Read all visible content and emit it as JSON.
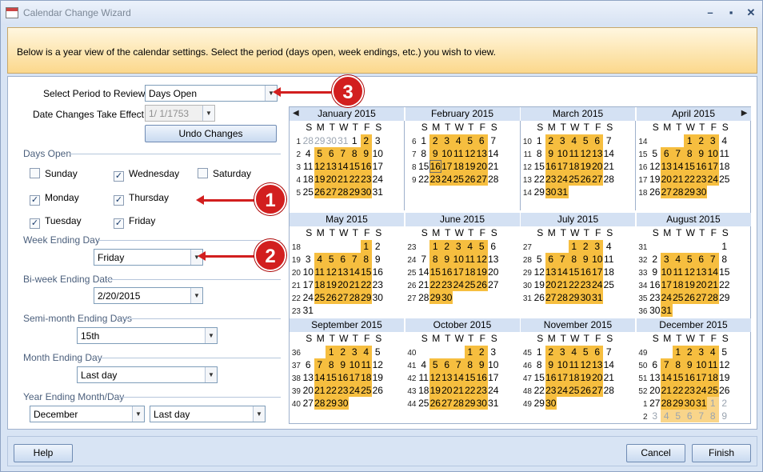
{
  "window": {
    "title": "Calendar Change Wizard",
    "min_icon": "minimize-icon",
    "max_icon": "maximize-icon",
    "close_icon": "close-icon"
  },
  "banner": {
    "text": "Below is a year view of the calendar settings. Select the period (days open, week endings, etc.) you wish to view."
  },
  "form": {
    "period_label": "Select Period to Review:",
    "period_value": "Days Open",
    "effect_label": "Date Changes Take Effect:",
    "effect_value": "1/  1/1753",
    "undo_label": "Undo Changes",
    "days_open_title": "Days Open",
    "days": [
      {
        "label": "Sunday",
        "checked": false
      },
      {
        "label": "Wednesday",
        "checked": true
      },
      {
        "label": "Saturday",
        "checked": false
      },
      {
        "label": "Monday",
        "checked": true
      },
      {
        "label": "Thursday",
        "checked": true
      },
      {
        "label": "Tuesday",
        "checked": true
      },
      {
        "label": "Friday",
        "checked": true
      }
    ],
    "week_end_title": "Week Ending Day",
    "week_end_value": "Friday",
    "biweek_title": "Bi-week Ending Date",
    "biweek_value": "2/20/2015",
    "semimonth_title": "Semi-month Ending Days",
    "semimonth_value": "15th",
    "month_end_title": "Month Ending Day",
    "month_end_value": "Last day",
    "year_end_title": "Year Ending Month/Day",
    "year_end_month": "December",
    "year_end_day": "Last day"
  },
  "callouts": [
    "1",
    "2",
    "3"
  ],
  "calendar": {
    "dow": [
      "S",
      "M",
      "T",
      "W",
      "T",
      "F",
      "S"
    ],
    "highlight_color": "#f6be3f",
    "months": [
      {
        "name": "January 2015",
        "weeks": [
          [
            1,
            "28*",
            "29*",
            "30*",
            "31*",
            1,
            2,
            3
          ],
          [
            2,
            4,
            5,
            6,
            7,
            8,
            9,
            10
          ],
          [
            3,
            11,
            12,
            13,
            14,
            15,
            16,
            17
          ],
          [
            4,
            18,
            19,
            20,
            21,
            22,
            23,
            24
          ],
          [
            5,
            25,
            26,
            27,
            28,
            29,
            30,
            31
          ]
        ]
      },
      {
        "name": "February 2015",
        "weeks": [
          [
            6,
            1,
            2,
            3,
            4,
            5,
            6,
            7
          ],
          [
            7,
            8,
            9,
            10,
            11,
            12,
            13,
            14
          ],
          [
            8,
            15,
            16,
            17,
            18,
            19,
            20,
            21
          ],
          [
            9,
            22,
            23,
            24,
            25,
            26,
            27,
            28
          ]
        ]
      },
      {
        "name": "March 2015",
        "weeks": [
          [
            10,
            1,
            2,
            3,
            4,
            5,
            6,
            7
          ],
          [
            11,
            8,
            9,
            10,
            11,
            12,
            13,
            14
          ],
          [
            12,
            15,
            16,
            17,
            18,
            19,
            20,
            21
          ],
          [
            13,
            22,
            23,
            24,
            25,
            26,
            27,
            28
          ],
          [
            14,
            29,
            30,
            31,
            "",
            "",
            "",
            ""
          ]
        ]
      },
      {
        "name": "April 2015",
        "weeks": [
          [
            14,
            "",
            "",
            "",
            1,
            2,
            3,
            4
          ],
          [
            15,
            5,
            6,
            7,
            8,
            9,
            10,
            11
          ],
          [
            16,
            12,
            13,
            14,
            15,
            16,
            17,
            18
          ],
          [
            17,
            19,
            20,
            21,
            22,
            23,
            24,
            25
          ],
          [
            18,
            26,
            27,
            28,
            29,
            30,
            "",
            ""
          ]
        ]
      },
      {
        "name": "May 2015",
        "weeks": [
          [
            18,
            "",
            "",
            "",
            "",
            "",
            1,
            2
          ],
          [
            19,
            3,
            4,
            5,
            6,
            7,
            8,
            9
          ],
          [
            20,
            10,
            11,
            12,
            13,
            14,
            15,
            16
          ],
          [
            21,
            17,
            18,
            19,
            20,
            21,
            22,
            23
          ],
          [
            22,
            24,
            25,
            26,
            27,
            28,
            29,
            30
          ],
          [
            23,
            31,
            "",
            "",
            "",
            "",
            "",
            ""
          ]
        ]
      },
      {
        "name": "June 2015",
        "weeks": [
          [
            23,
            "",
            1,
            2,
            3,
            4,
            5,
            6
          ],
          [
            24,
            7,
            8,
            9,
            10,
            11,
            12,
            13
          ],
          [
            25,
            14,
            15,
            16,
            17,
            18,
            19,
            20
          ],
          [
            26,
            21,
            22,
            23,
            24,
            25,
            26,
            27
          ],
          [
            27,
            28,
            29,
            30,
            "",
            "",
            "",
            ""
          ]
        ]
      },
      {
        "name": "July 2015",
        "weeks": [
          [
            27,
            "",
            "",
            "",
            1,
            2,
            3,
            4
          ],
          [
            28,
            5,
            6,
            7,
            8,
            9,
            10,
            11
          ],
          [
            29,
            12,
            13,
            14,
            15,
            16,
            17,
            18
          ],
          [
            30,
            19,
            20,
            21,
            22,
            23,
            24,
            25
          ],
          [
            31,
            26,
            27,
            28,
            29,
            30,
            31,
            ""
          ]
        ]
      },
      {
        "name": "August 2015",
        "weeks": [
          [
            31,
            "",
            "",
            "",
            "",
            "",
            "",
            1
          ],
          [
            32,
            2,
            3,
            4,
            5,
            6,
            7,
            8
          ],
          [
            33,
            9,
            10,
            11,
            12,
            13,
            14,
            15
          ],
          [
            34,
            16,
            17,
            18,
            19,
            20,
            21,
            22
          ],
          [
            35,
            23,
            24,
            25,
            26,
            27,
            28,
            29
          ],
          [
            36,
            30,
            31,
            "",
            "",
            "",
            "",
            ""
          ]
        ]
      },
      {
        "name": "September 2015",
        "weeks": [
          [
            36,
            "",
            "",
            1,
            2,
            3,
            4,
            5
          ],
          [
            37,
            6,
            7,
            8,
            9,
            10,
            11,
            12
          ],
          [
            38,
            13,
            14,
            15,
            16,
            17,
            18,
            19
          ],
          [
            39,
            20,
            21,
            22,
            23,
            24,
            25,
            26
          ],
          [
            40,
            27,
            28,
            29,
            30,
            "",
            "",
            ""
          ]
        ]
      },
      {
        "name": "October 2015",
        "weeks": [
          [
            40,
            "",
            "",
            "",
            "",
            1,
            2,
            3
          ],
          [
            41,
            4,
            5,
            6,
            7,
            8,
            9,
            10
          ],
          [
            42,
            11,
            12,
            13,
            14,
            15,
            16,
            17
          ],
          [
            43,
            18,
            19,
            20,
            21,
            22,
            23,
            24
          ],
          [
            44,
            25,
            26,
            27,
            28,
            29,
            30,
            31
          ]
        ]
      },
      {
        "name": "November 2015",
        "weeks": [
          [
            45,
            1,
            2,
            3,
            4,
            5,
            6,
            7
          ],
          [
            46,
            8,
            9,
            10,
            11,
            12,
            13,
            14
          ],
          [
            47,
            15,
            16,
            17,
            18,
            19,
            20,
            21
          ],
          [
            48,
            22,
            23,
            24,
            25,
            26,
            27,
            28
          ],
          [
            49,
            29,
            30,
            "",
            "",
            "",
            "",
            ""
          ]
        ]
      },
      {
        "name": "December 2015",
        "weeks": [
          [
            49,
            "",
            "",
            1,
            2,
            3,
            4,
            5
          ],
          [
            50,
            6,
            7,
            8,
            9,
            10,
            11,
            12
          ],
          [
            51,
            13,
            14,
            15,
            16,
            17,
            18,
            19
          ],
          [
            52,
            20,
            21,
            22,
            23,
            24,
            25,
            26
          ],
          [
            1,
            27,
            28,
            29,
            30,
            31,
            "1*",
            "2*"
          ],
          [
            2,
            "3*",
            "4*",
            "5*",
            "6*",
            "7*",
            "8*",
            "9*"
          ]
        ]
      }
    ]
  },
  "buttons": {
    "help": "Help",
    "cancel": "Cancel",
    "finish": "Finish"
  }
}
